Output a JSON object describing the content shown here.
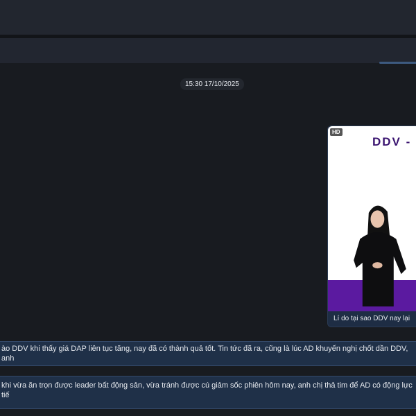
{
  "timestamp": "15:30 17/10/2025",
  "video": {
    "badge": "HD",
    "title": "DDV -",
    "caption": "Lí do tại sao DDV nay lại"
  },
  "messages": [
    {
      "text": "ào DDV khi thấy giá DAP liên tục tăng, nay đã có thành quả tốt. Tin tức đã ra, cũng là lúc AD khuyến nghị chốt dần DDV, anh"
    },
    {
      "text": "khi vừa ăn trọn được leader bất động sản, vừa tránh được cú giảm sốc phiên hôm nay, anh chị thả tim để AD có động lực tiế"
    }
  ]
}
